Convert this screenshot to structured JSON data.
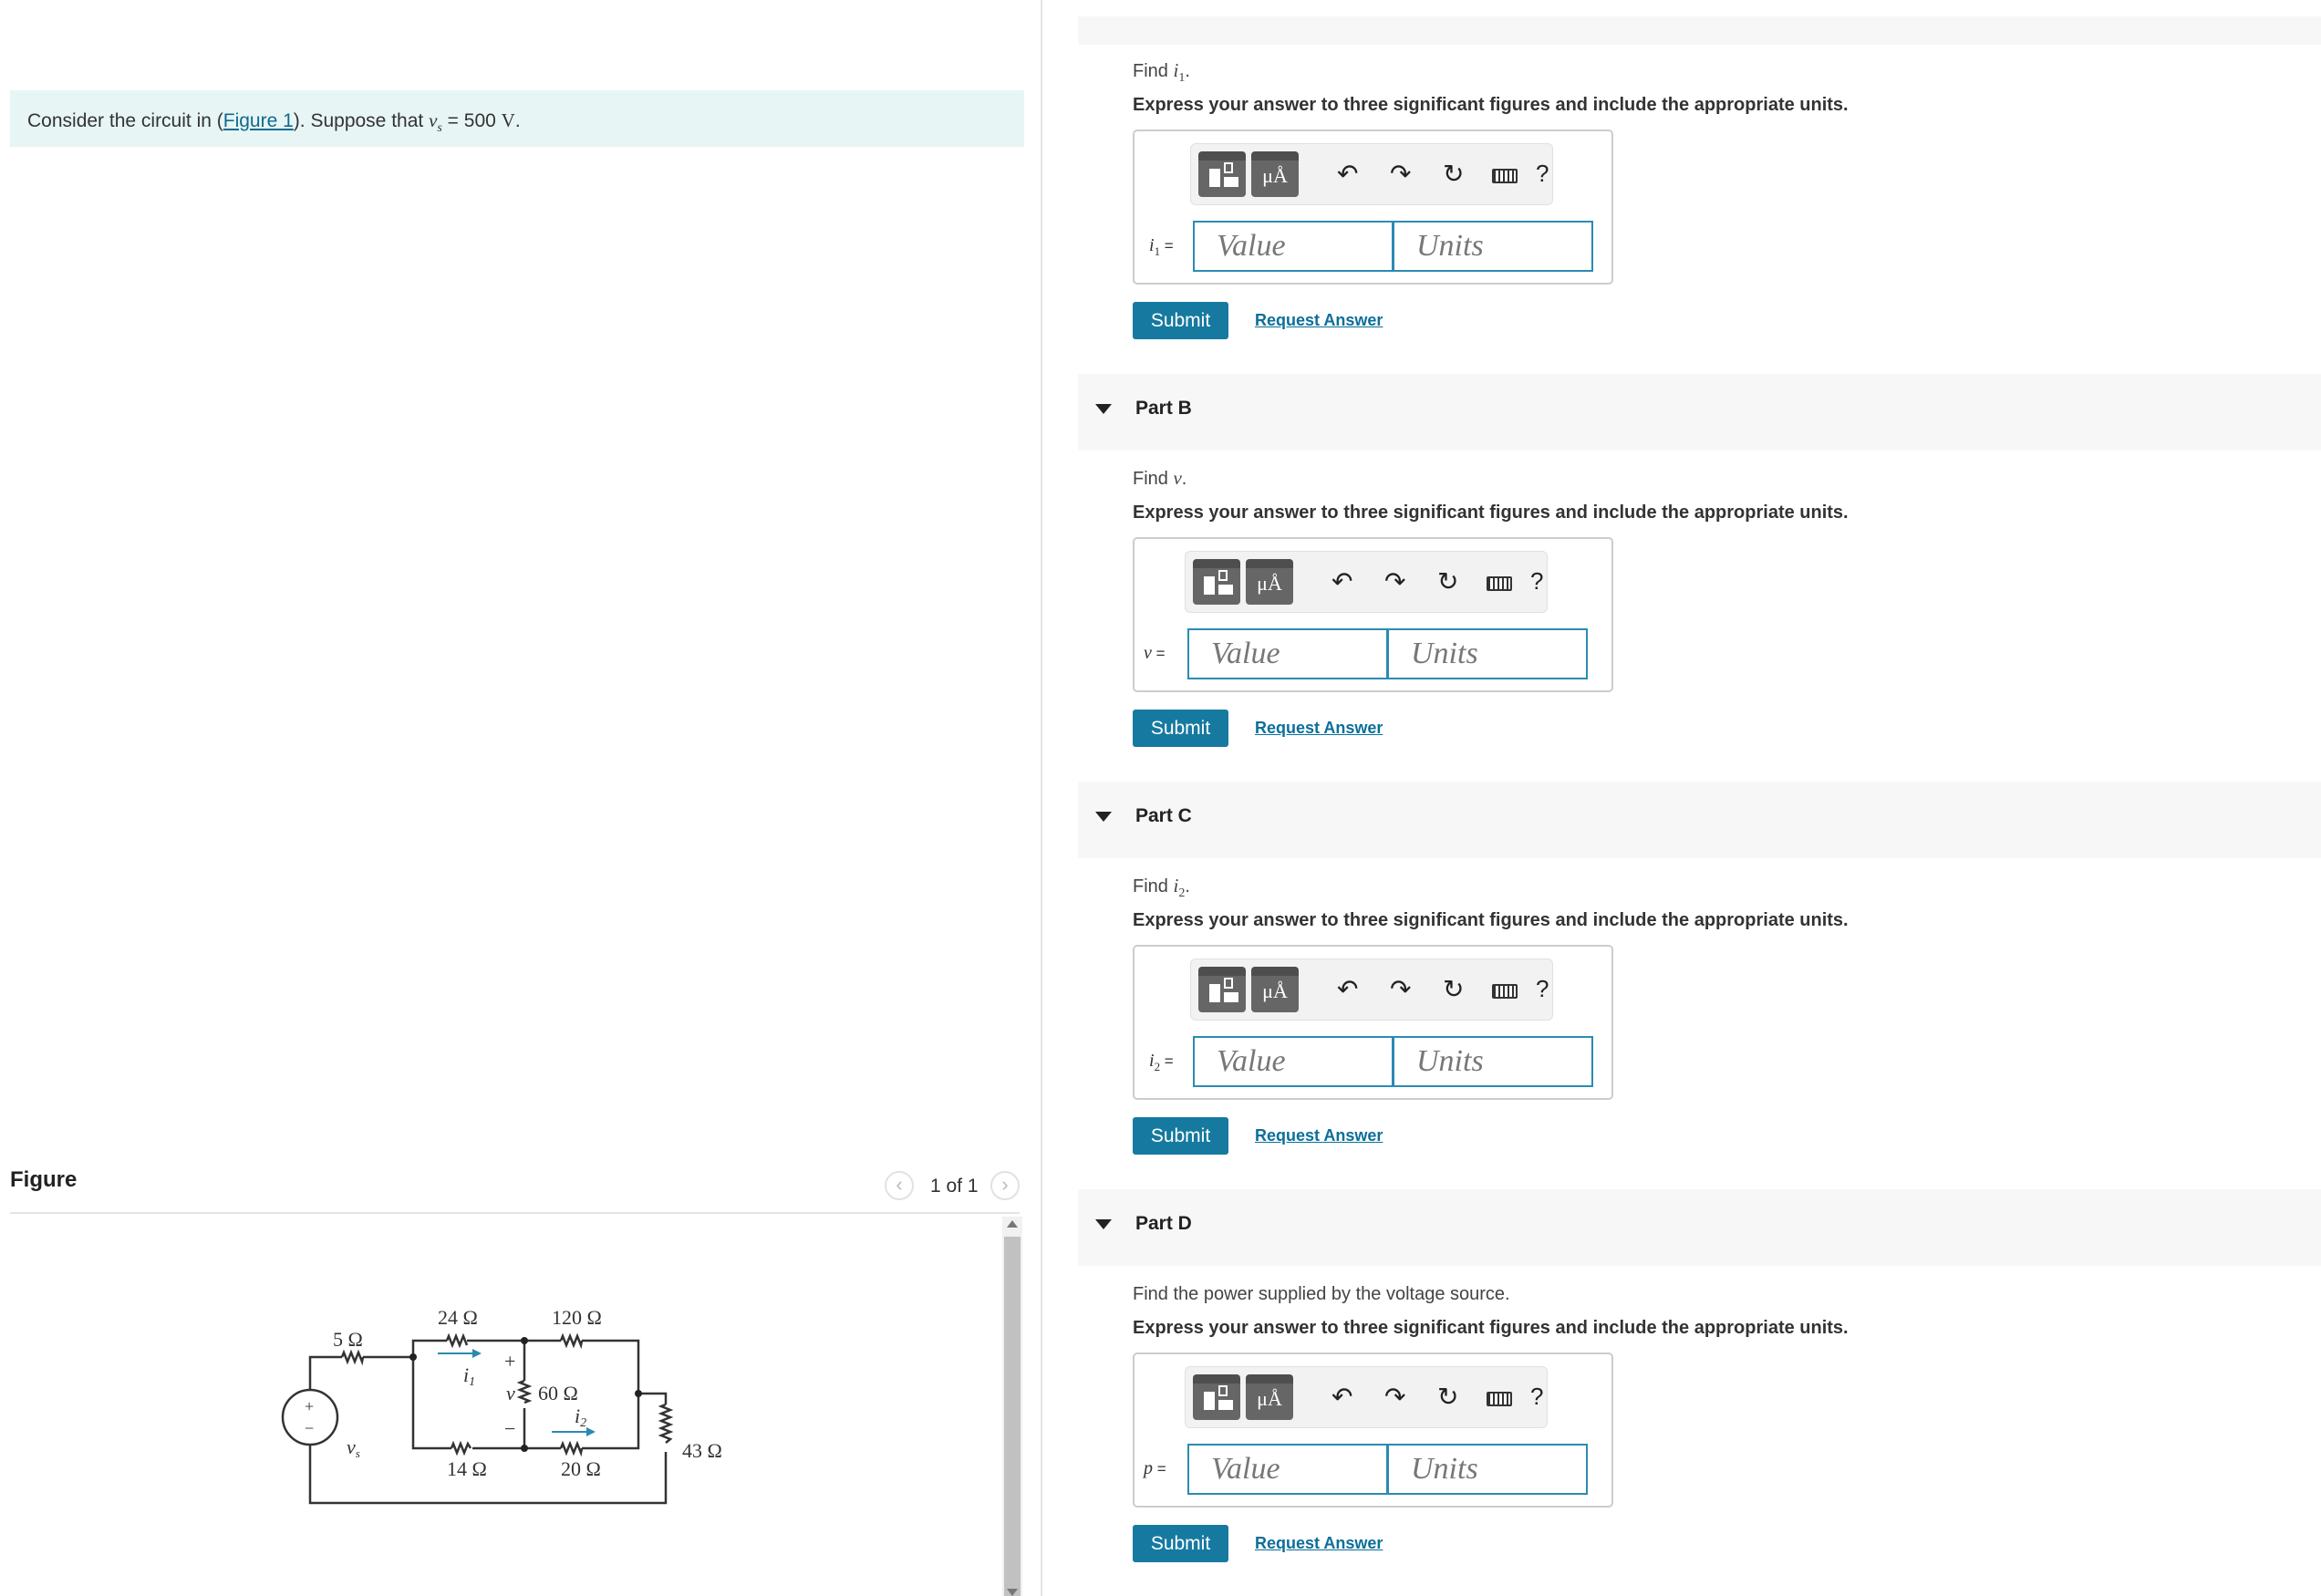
{
  "problem": {
    "text_before": "Consider the circuit in (",
    "figure_link": "Figure 1",
    "text_after": "). Suppose that ",
    "var": "v",
    "sub": "s",
    "value": " = 500 ",
    "unit": "V",
    "period": "."
  },
  "figure": {
    "title": "Figure",
    "pager": "1 of 1",
    "circuit": {
      "r1": "5 Ω",
      "r2": "24 Ω",
      "r3": "120 Ω",
      "r4": "60 Ω",
      "r5": "14 Ω",
      "r6": "20 Ω",
      "r7": "43 Ω",
      "i1": "i",
      "i1_sub": "1",
      "i2": "i",
      "i2_sub": "2",
      "v": "v",
      "vs": "v",
      "vs_sub": "s",
      "plus": "+",
      "minus": "−"
    }
  },
  "parts": [
    {
      "title": "",
      "find": "Find ",
      "find_var": "i",
      "find_sub": "1",
      "find_end": ".",
      "express": "Express your answer to three significant figures and include the appropriate units.",
      "label_var": "i",
      "label_sub": "1",
      "label_eq": " =",
      "value_placeholder": "Value",
      "units_placeholder": "Units",
      "submit": "Submit",
      "request": "Request Answer"
    },
    {
      "title": "Part B",
      "find": "Find ",
      "find_var": "v",
      "find_sub": "",
      "find_end": ".",
      "express": "Express your answer to three significant figures and include the appropriate units.",
      "label_var": "v",
      "label_sub": "",
      "label_eq": " =",
      "value_placeholder": "Value",
      "units_placeholder": "Units",
      "submit": "Submit",
      "request": "Request Answer"
    },
    {
      "title": "Part C",
      "find": "Find ",
      "find_var": "i",
      "find_sub": "2",
      "find_end": ".",
      "express": "Express your answer to three significant figures and include the appropriate units.",
      "label_var": "i",
      "label_sub": "2",
      "label_eq": " =",
      "value_placeholder": "Value",
      "units_placeholder": "Units",
      "submit": "Submit",
      "request": "Request Answer"
    },
    {
      "title": "Part D",
      "find": "Find the power supplied by the voltage source.",
      "find_var": "",
      "find_sub": "",
      "find_end": "",
      "express": "Express your answer to three significant figures and include the appropriate units.",
      "label_var": "p",
      "label_sub": "",
      "label_eq": " =",
      "value_placeholder": "Value",
      "units_placeholder": "Units",
      "submit": "Submit",
      "request": "Request Answer"
    }
  ],
  "toolbar": {
    "units_button": "μÅ",
    "help": "?",
    "icons": [
      "templates-icon",
      "units-icon",
      "undo-icon",
      "redo-icon",
      "reset-icon",
      "keyboard-icon",
      "help-icon"
    ]
  }
}
